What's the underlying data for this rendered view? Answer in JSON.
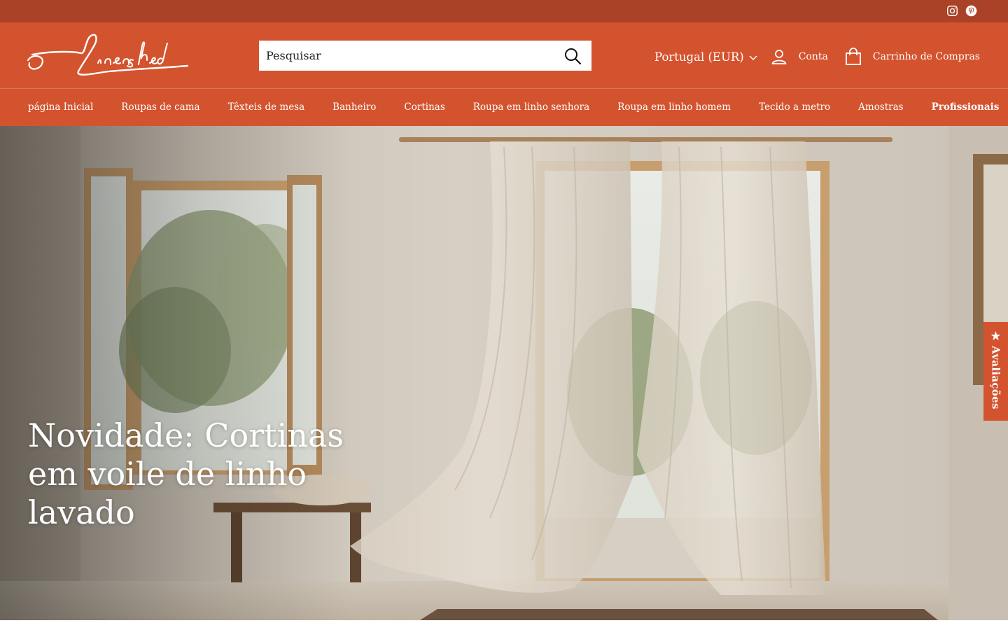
{
  "brand": {
    "logo_text": "Linenshed"
  },
  "topbar": {
    "icons": [
      "instagram-icon",
      "pinterest-icon"
    ]
  },
  "header": {
    "search_placeholder": "Pesquisar",
    "locale": "Portugal (EUR)",
    "account_label": "Conta",
    "cart_label": "Carrinho de Compras"
  },
  "nav": {
    "items": [
      {
        "label": "página Inicial"
      },
      {
        "label": "Roupas de cama"
      },
      {
        "label": "Têxteis de mesa"
      },
      {
        "label": "Banheiro"
      },
      {
        "label": "Cortinas"
      },
      {
        "label": "Roupa em linho senhora"
      },
      {
        "label": "Roupa em linho homem"
      },
      {
        "label": "Tecido a metro"
      },
      {
        "label": "Amostras"
      },
      {
        "label": "Profissionais"
      }
    ]
  },
  "hero": {
    "title": "Novidade: Cortinas em voile de linho lavado"
  },
  "reviews_tab": {
    "label": "Avaliações"
  },
  "colors": {
    "brand": "#d4532f",
    "topbar": "#a94226"
  }
}
